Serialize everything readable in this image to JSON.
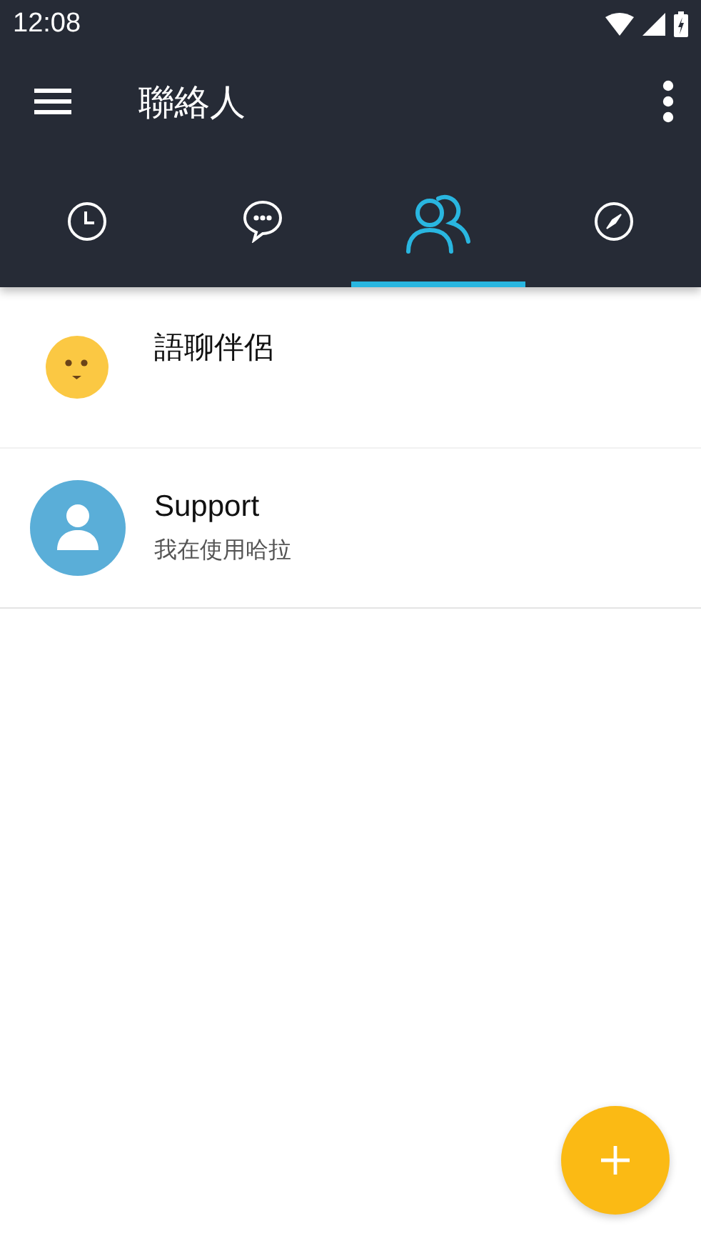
{
  "status_bar": {
    "time": "12:08"
  },
  "toolbar": {
    "title": "聯絡人"
  },
  "tabs": [
    {
      "kind": "clock",
      "selected": false
    },
    {
      "kind": "chat",
      "selected": false
    },
    {
      "kind": "contacts",
      "selected": true
    },
    {
      "kind": "compass",
      "selected": false
    }
  ],
  "contacts": [
    {
      "kind": "emoji",
      "name": "語聊伴侶"
    },
    {
      "kind": "person",
      "name": "Support",
      "status": "我在使用哈拉"
    }
  ]
}
